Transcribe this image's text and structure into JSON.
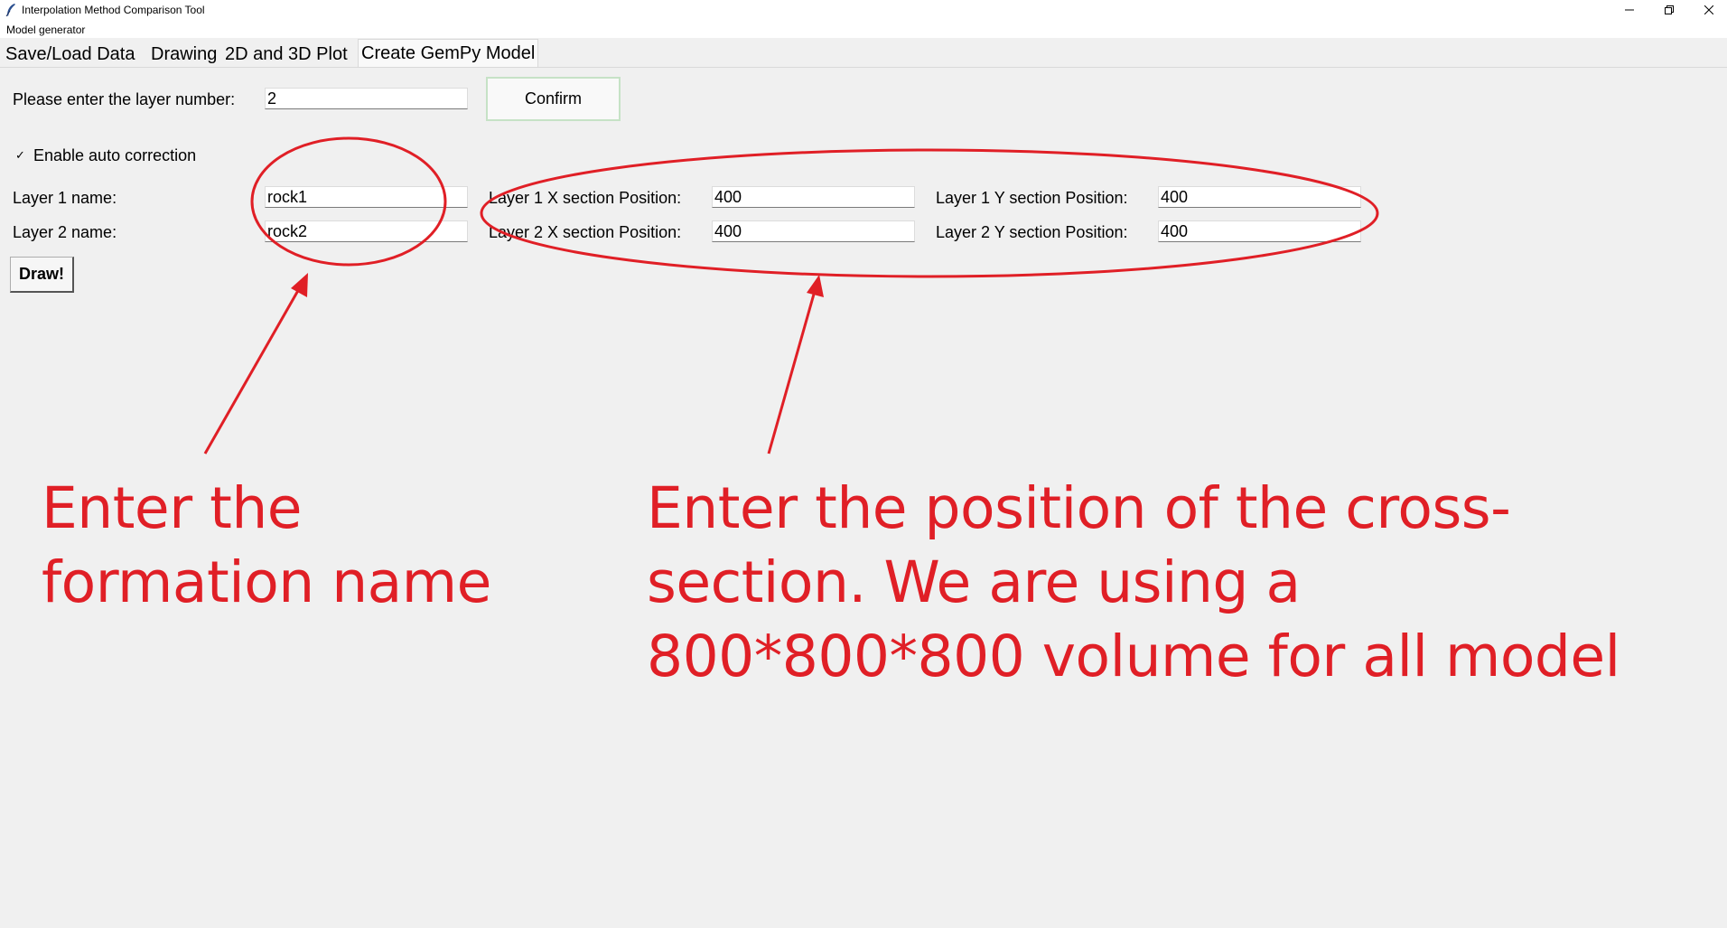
{
  "window": {
    "title": "Interpolation Method Comparison Tool",
    "icon": "feather-icon",
    "controls": [
      "minimize-icon",
      "restore-icon",
      "close-icon"
    ]
  },
  "menu": {
    "items": [
      "Model generator"
    ]
  },
  "tabs": [
    {
      "label": "Save/Load Data",
      "active": false
    },
    {
      "label": "Drawing",
      "active": false
    },
    {
      "label": "2D and 3D Plot",
      "active": false
    },
    {
      "label": "Create GemPy Model",
      "active": true
    }
  ],
  "form": {
    "layer_number_label": "Please enter the layer number:",
    "layer_number_value": "2",
    "confirm_label": "Confirm",
    "auto_correction_label": "Enable auto correction",
    "auto_correction_checked": true,
    "checkbox_mark": "✓",
    "layers": [
      {
        "name_label": "Layer 1 name:",
        "name_value": "rock1",
        "x_label": "Layer 1 X section Position:",
        "x_value": "400",
        "y_label": "Layer 1 Y section Position:",
        "y_value": "400"
      },
      {
        "name_label": "Layer 2 name:",
        "name_value": "rock2",
        "x_label": "Layer 2 X section Position:",
        "x_value": "400",
        "y_label": "Layer 2 Y section Position:",
        "y_value": "400"
      }
    ],
    "draw_label": "Draw!"
  },
  "annotations": {
    "color": "#e01f26",
    "left_text": "Enter the formation name",
    "right_text": "Enter the position of the cross-section. We are using a 800*800*800 volume for all model"
  }
}
